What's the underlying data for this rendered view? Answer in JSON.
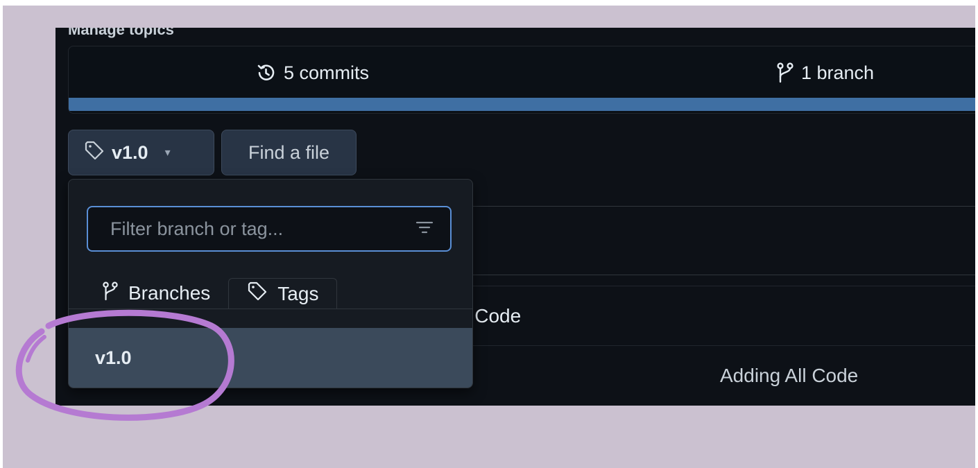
{
  "header": {
    "manage_topics": "Manage topics"
  },
  "stats": {
    "commits": "5 commits",
    "branch": "1 branch"
  },
  "toolbar": {
    "tag_selector": "v1.0",
    "find_file": "Find a file"
  },
  "dropdown": {
    "filter_placeholder": "Filter branch or tag...",
    "tabs": [
      {
        "label": "Branches"
      },
      {
        "label": "Tags"
      }
    ],
    "items": [
      {
        "label": "v1.0"
      }
    ]
  },
  "file_list": {
    "commit_message_partial": "ll Code",
    "commit_message": "Adding All Code"
  },
  "colors": {
    "page_background": "#cbc1d0",
    "panel_background": "#0d1117",
    "language_bar": "#3f6fa3",
    "selected_item": "#3b4a5b",
    "focus_border": "#5a8fd6",
    "annotation": "#b57ad2"
  },
  "icons": {
    "commits": "history-icon",
    "branch": "git-branch-icon",
    "tag": "tag-icon",
    "caret": "triangle-down-icon",
    "filter": "filter-lines-icon"
  }
}
